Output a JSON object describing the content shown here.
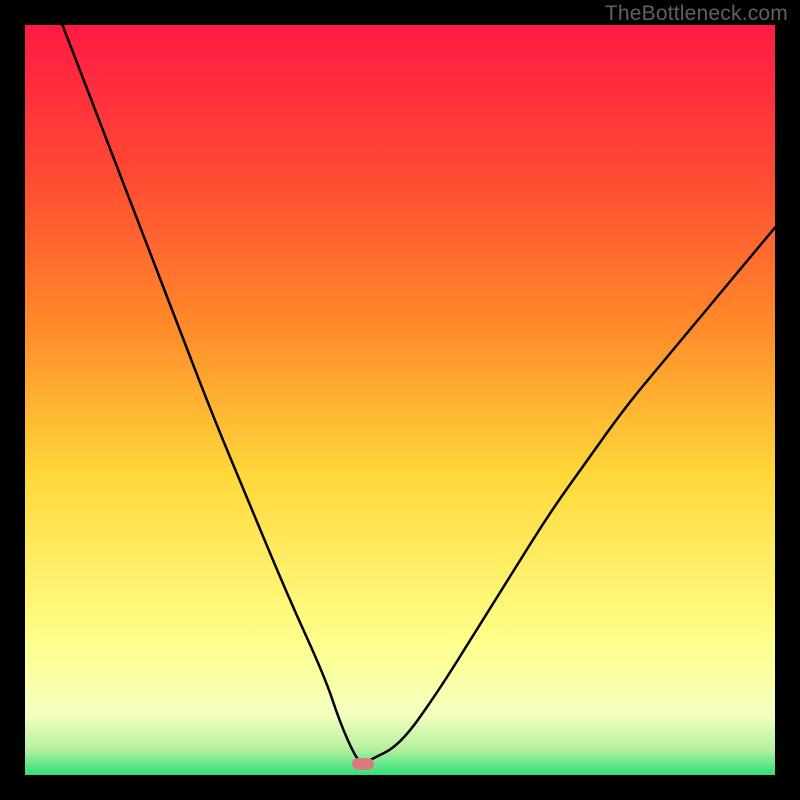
{
  "watermark_text": "TheBottleneck.com",
  "colors": {
    "top": "#ff1a44",
    "mid_upper": "#ff8a2a",
    "mid": "#ffd83a",
    "mid_lower": "#ffff8a",
    "green_pale": "#c8f5b4",
    "green": "#2fe07a",
    "black": "#000000",
    "curve": "#000000",
    "marker": "#d87a7e"
  },
  "chart_data": {
    "type": "line",
    "title": "",
    "xlabel": "",
    "ylabel": "",
    "xlim": [
      0,
      100
    ],
    "ylim": [
      0,
      100
    ],
    "grid": false,
    "legend": false,
    "series": [
      {
        "name": "bottleneck-curve",
        "x": [
          5,
          10,
          15,
          20,
          25,
          30,
          35,
          40,
          42,
          44,
          45,
          46,
          50,
          55,
          60,
          65,
          70,
          75,
          80,
          85,
          90,
          95,
          100
        ],
        "y": [
          100,
          87,
          74,
          61,
          48,
          36,
          24,
          13,
          7,
          2.5,
          1.5,
          2,
          4,
          11,
          19,
          27,
          35,
          42,
          49,
          55,
          61,
          67,
          73
        ]
      }
    ],
    "annotations": [
      {
        "name": "optimal-marker",
        "x": 45,
        "y": 1.5
      }
    ],
    "background_gradient_stops": [
      {
        "pos": 0.0,
        "color": "#ff1a44"
      },
      {
        "pos": 0.2,
        "color": "#ff4a33"
      },
      {
        "pos": 0.4,
        "color": "#ff8a2a"
      },
      {
        "pos": 0.6,
        "color": "#ffd83a"
      },
      {
        "pos": 0.82,
        "color": "#ffff8a"
      },
      {
        "pos": 0.92,
        "color": "#f4ffc0"
      },
      {
        "pos": 0.965,
        "color": "#b6f0a0"
      },
      {
        "pos": 1.0,
        "color": "#2fe07a"
      }
    ]
  }
}
